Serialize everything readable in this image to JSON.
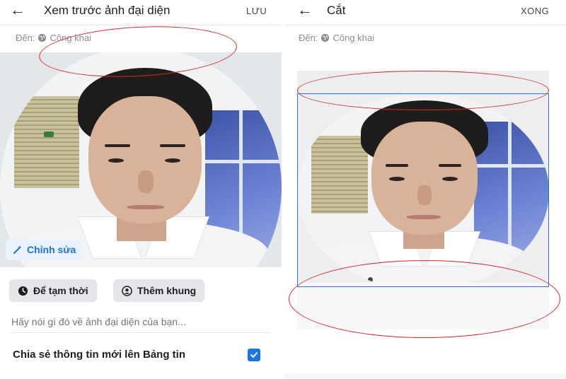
{
  "left": {
    "back_icon": "arrow-left-icon",
    "title": "Xem trước ảnh đại diện",
    "action": "LƯU",
    "audience_prefix": "Đến:",
    "audience_value": "Công khai",
    "edit_label": "Chỉnh sửa",
    "chips": {
      "temporary": "Để tạm thời",
      "frame": "Thêm khung"
    },
    "caption_placeholder": "Hãy nói gì đó về ảnh đại diện của bạn...",
    "share_label": "Chia sẻ thông tin mới lên Bảng tin",
    "share_checked": true
  },
  "right": {
    "back_icon": "arrow-left-icon",
    "title": "Cắt",
    "action": "XONG",
    "audience_prefix": "Đến:",
    "audience_value": "Công khai"
  },
  "colors": {
    "accent": "#1b74e4",
    "annotation": "#d9262b",
    "crop_border": "#2e6fd4",
    "text_muted": "#8a8d91"
  }
}
